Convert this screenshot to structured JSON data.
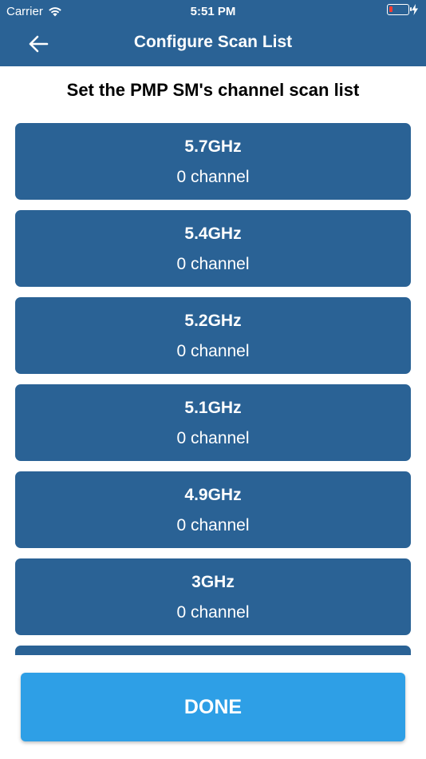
{
  "status_bar": {
    "carrier": "Carrier",
    "time": "5:51 PM"
  },
  "header": {
    "title": "Configure Scan List"
  },
  "subtitle": "Set the PMP SM's channel scan list",
  "bands": [
    {
      "freq": "5.7GHz",
      "count": "0 channel"
    },
    {
      "freq": "5.4GHz",
      "count": "0 channel"
    },
    {
      "freq": "5.2GHz",
      "count": "0 channel"
    },
    {
      "freq": "5.1GHz",
      "count": "0 channel"
    },
    {
      "freq": "4.9GHz",
      "count": "0 channel"
    },
    {
      "freq": "3GHz",
      "count": "0 channel"
    },
    {
      "freq": "",
      "count": ""
    }
  ],
  "done_button": {
    "label": "DONE"
  },
  "colors": {
    "header": "#2a6295",
    "card": "#2a6295",
    "done": "#2e9fe6",
    "battery_low": "#ff3b30"
  }
}
